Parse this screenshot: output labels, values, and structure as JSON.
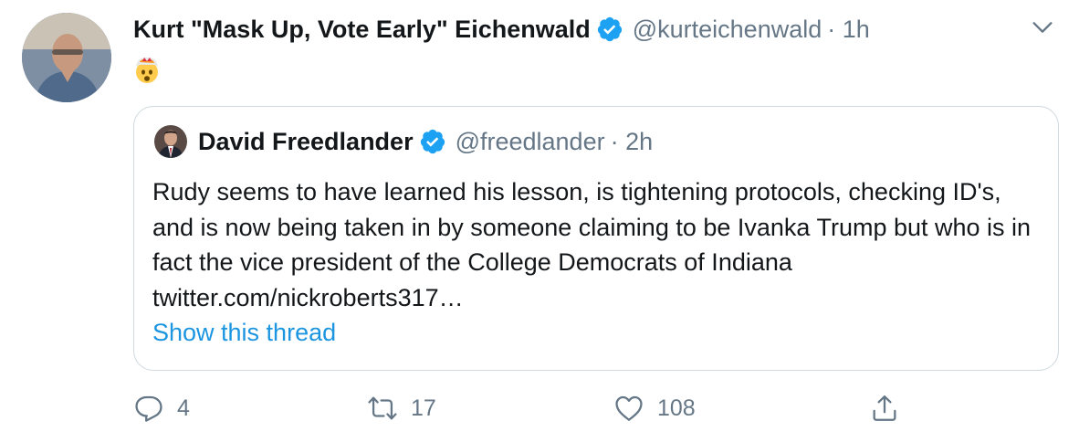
{
  "tweet": {
    "author": {
      "display_name": "Kurt \"Mask Up, Vote Early\" Eichenwald",
      "handle": "@kurteichenwald",
      "time": "· 1h",
      "verified": true
    },
    "body_emoji": "exploding-head",
    "menu_icon": "chevron-down-icon"
  },
  "quote": {
    "author": {
      "display_name": "David Freedlander",
      "handle": "@freedlander",
      "time": "· 2h",
      "verified": true
    },
    "text": "Rudy seems to have learned his lesson, is tightening protocols, checking ID's, and is now being taken in by someone claiming to be Ivanka Trump but who is in fact the vice president of the College Democrats of Indiana twitter.com/nickroberts317…",
    "show_thread": "Show this thread"
  },
  "actions": {
    "reply": {
      "icon": "reply-icon",
      "count": "4"
    },
    "retweet": {
      "icon": "retweet-icon",
      "count": "17"
    },
    "like": {
      "icon": "heart-icon",
      "count": "108"
    },
    "share": {
      "icon": "share-icon"
    }
  },
  "colors": {
    "text": "#14171a",
    "secondary": "#657786",
    "link": "#1b95e0",
    "verified": "#1da1f2",
    "border": "#cfd9de"
  }
}
